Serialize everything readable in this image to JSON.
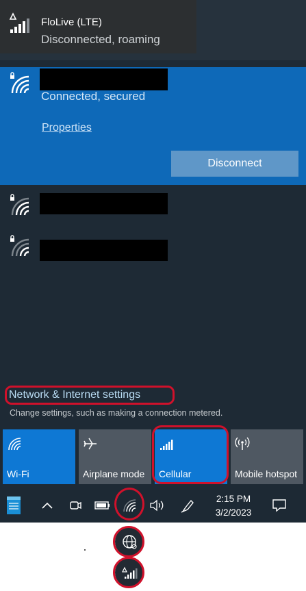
{
  "cellular_network": {
    "name": "FloLive (LTE)",
    "status": "Disconnected, roaming",
    "icon": "cellular-signal-icon"
  },
  "connected_wifi": {
    "status": "Connected, secured",
    "properties_label": "Properties",
    "disconnect_label": "Disconnect",
    "icon": "wifi-secured-icon"
  },
  "other_wifi": [
    {
      "icon": "wifi-secured-icon"
    },
    {
      "icon": "wifi-secured-icon"
    }
  ],
  "settings": {
    "link_label": "Network & Internet settings",
    "description": "Change settings, such as making a connection metered."
  },
  "quick_actions": [
    {
      "label": "Wi-Fi",
      "active": true,
      "icon": "wifi-icon"
    },
    {
      "label": "Airplane mode",
      "active": false,
      "icon": "airplane-icon"
    },
    {
      "label": "Cellular",
      "active": true,
      "icon": "cellular-icon"
    },
    {
      "label": "Mobile hotspot",
      "active": false,
      "icon": "hotspot-icon"
    }
  ],
  "taskbar": {
    "time": "2:15 PM",
    "date": "3/2/2023"
  },
  "colors": {
    "accent": "#0e78d4",
    "flyout_bg": "#1e2a35",
    "highlight_red": "#d0112b"
  }
}
